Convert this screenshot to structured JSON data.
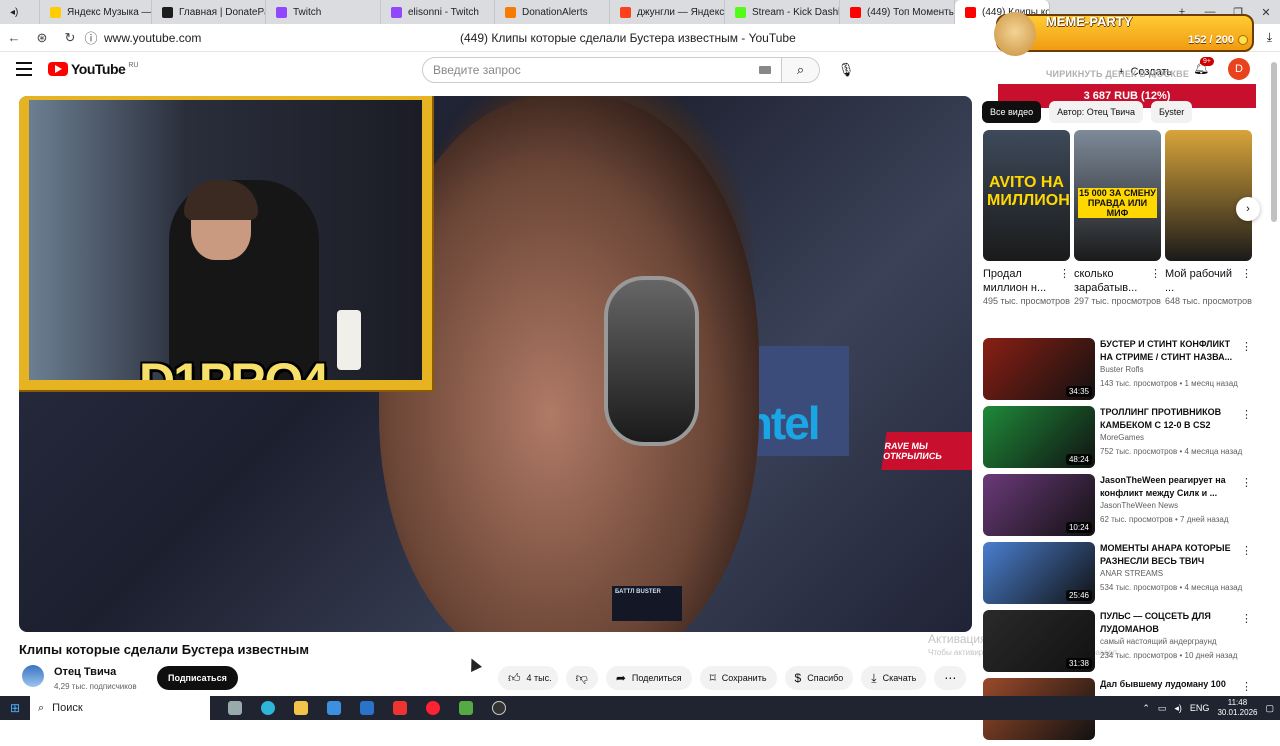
{
  "browser": {
    "tabs": [
      {
        "label": "Яндекс Музыка — со",
        "color": "#ffcc00"
      },
      {
        "label": "Главная | DonatePay",
        "color": "#1d1d1d"
      },
      {
        "label": "Twitch",
        "color": "#9146ff"
      },
      {
        "label": "elisonni - Twitch",
        "color": "#9146ff"
      },
      {
        "label": "DonationAlerts",
        "color": "#f57c00"
      },
      {
        "label": "джунгли — Яндекс:",
        "color": "#fc3f1d"
      },
      {
        "label": "Stream - Kick Dashbo",
        "color": "#53fc18"
      },
      {
        "label": "(449) Топ Моменты с",
        "color": "#ff0000"
      },
      {
        "label": "(449) Клипы ко",
        "color": "#ff0000"
      }
    ],
    "url": "www.youtube.com",
    "page_title": "(449) Клипы которые сделали Бустера известным - YouTube"
  },
  "header": {
    "logo_text": "YouTube",
    "logo_region": "RU",
    "search_placeholder": "Введите запрос",
    "create_label": "Создать",
    "notif_count": "9+",
    "avatar_letter": "D"
  },
  "overlay": {
    "meme_title": "MEME-PARTY",
    "meme_count": "152 / 200",
    "donate_title": "ЧИРИКНУТЬ ДЕНЕК В МОСКВЕ",
    "donate_amount": "3 687 RUB (12%)"
  },
  "video": {
    "cam_name": "D1PRO4",
    "intel_text": "intel",
    "rave_text": "RAVE МЫ ОТКРЫЛИСЬ",
    "battle_text": "БАТТЛ BUSTER",
    "title": "Клипы которые сделали Бустера известным",
    "channel": "Отец Твича",
    "subscribers": "4,29 тыс. подписчиков",
    "subscribe_label": "Подписаться",
    "actions": {
      "likes": "4 тыс.",
      "share": "Поделиться",
      "save": "Сохранить",
      "thanks": "Спасибо",
      "download": "Скачать"
    },
    "watermark_line1": "Активация",
    "watermark_line2": "Чтобы активировать Windows, перейдите в раздел"
  },
  "sidebar": {
    "chips": [
      "Все видео",
      "Автор: Отец Твича",
      "Буster"
    ],
    "shorts": [
      {
        "title": "Продал миллион н...",
        "views": "495 тыс. просмотров",
        "overlay": "AVITO НА МИЛЛИОН",
        "color": "#3e4a5a"
      },
      {
        "title": "сколько зарабатыв...",
        "views": "297 тыс. просмотров",
        "overlay": "15 000 ЗА СМЕНУ ПРАВДА ИЛИ МИФ",
        "color": "#7e8a99"
      },
      {
        "title": "Мой рабочий ...",
        "views": "648 тыс. просмотров",
        "overlay": "",
        "color": "#d8a43a"
      }
    ],
    "videos": [
      {
        "title": "БУСТЕР И СТИНТ КОНФЛИКТ НА СТРИМЕ / СТИНТ НАЗВА...",
        "channel": "Buster Rofls",
        "meta": "143 тыс. просмотров • 1 месяц назад",
        "duration": "34:35",
        "color": "#8a1f14"
      },
      {
        "title": "ТРОЛЛИНГ ПРОТИВНИКОВ КАМБЕКОМ С 12-0 В CS2",
        "channel": "MoreGames",
        "meta": "752 тыс. просмотров • 4 месяца назад",
        "duration": "48:24",
        "color": "#1e8a3a"
      },
      {
        "title": "JasonTheWeen реагирует на конфликт между Силк и ...",
        "channel": "JasonTheWeen News",
        "meta": "62 тыс. просмотров • 7 дней назад",
        "duration": "10:24",
        "color": "#6b3a7a"
      },
      {
        "title": "МОМЕНТЫ АНАРА КОТОРЫЕ РАЗНЕСЛИ ВЕСЬ ТВИЧ",
        "channel": "ANAR STREAMS",
        "meta": "534 тыс. просмотров • 4 месяца назад",
        "duration": "25:46",
        "color": "#4a7fd0"
      },
      {
        "title": "ПУЛЬС — СОЦСЕТЬ ДЛЯ ЛУДОМАНОВ",
        "channel": "самый настоящий андерграунд",
        "meta": "234 тыс. просмотров • 10 дней назад",
        "duration": "31:38",
        "color": "#2a2a2a"
      },
      {
        "title": "Дал бывшему лудоману 100",
        "channel": "",
        "meta": "",
        "duration": "",
        "color": "#9a4a2a"
      }
    ]
  },
  "taskbar": {
    "search_label": "Поиск",
    "lang": "ENG",
    "time": "11:48",
    "date": "30.01.2026"
  }
}
